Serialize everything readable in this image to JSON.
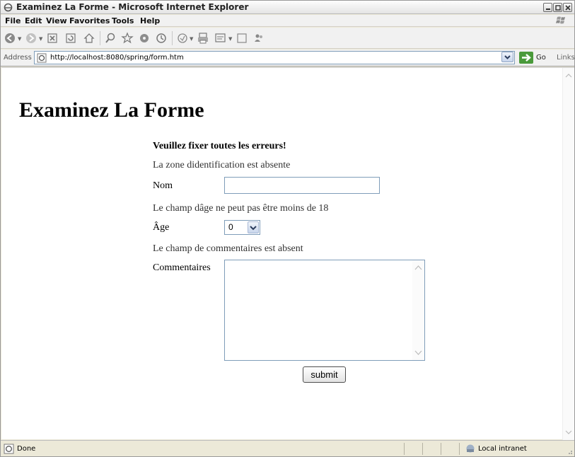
{
  "window": {
    "title": "Examinez La Forme - Microsoft Internet Explorer"
  },
  "menu": {
    "items": [
      "File",
      "Edit",
      "View",
      "Favorites",
      "Tools",
      "Help"
    ]
  },
  "address": {
    "label": "Address",
    "url": "http://localhost:8080/spring/form.htm",
    "go_label": "Go",
    "links_label": "Links"
  },
  "page": {
    "heading": "Examinez La Forme",
    "error_heading": "Veuillez fixer toutes les erreurs!",
    "error_id": "La zone didentification est absente",
    "nom_label": "Nom",
    "nom_value": "",
    "error_age": "Le champ dâge ne peut pas être moins de 18",
    "age_label": "Âge",
    "age_value": "0",
    "error_comment": "Le champ de commentaires est absent",
    "comment_label": "Commentaires",
    "comment_value": "",
    "submit_label": "submit"
  },
  "status": {
    "text": "Done",
    "zone": "Local intranet"
  },
  "colors": {
    "chrome": "#ece9d8",
    "go_green": "#4a9a3b",
    "field_border": "#7f9db9"
  }
}
